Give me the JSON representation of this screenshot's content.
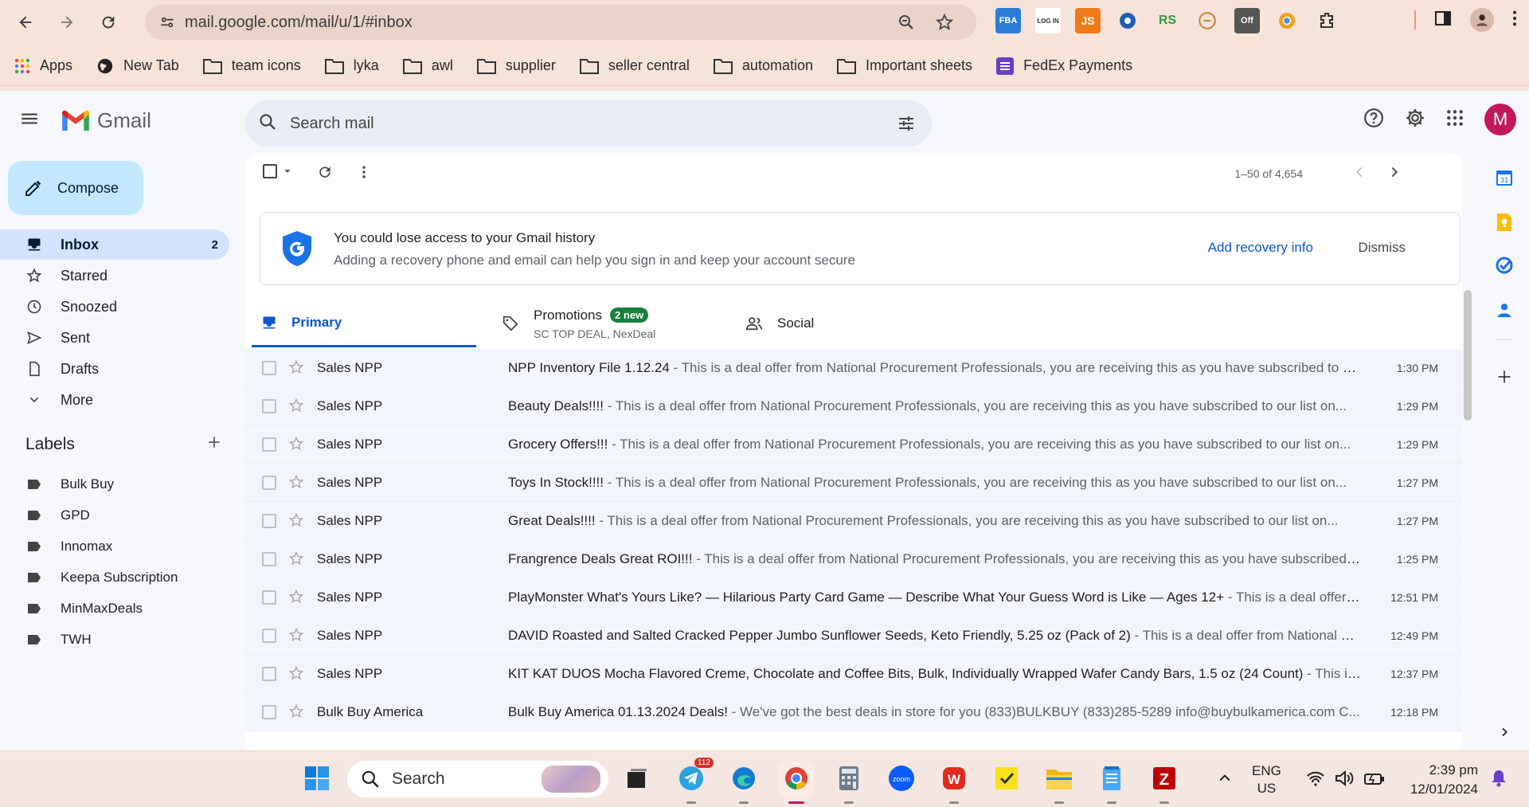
{
  "browser": {
    "url": "mail.google.com/mail/u/1/#inbox",
    "extensions": [
      {
        "name": "fba-ext",
        "label": "FBA",
        "color": "#2b7bd8"
      },
      {
        "name": "login-ext",
        "label": "LOG IN",
        "color": "#555555"
      },
      {
        "name": "js-ext",
        "label": "JS",
        "color": "#f07a1a"
      },
      {
        "name": "helper-ext",
        "label": "",
        "color": "#1e5fb0"
      },
      {
        "name": "rs-ext",
        "label": "RS",
        "color": "#2f9e44"
      },
      {
        "name": "seller-ext",
        "label": "",
        "color": "#c38a4a"
      },
      {
        "name": "off-ext",
        "label": "Off",
        "color": "#666666"
      },
      {
        "name": "chrome-ext",
        "label": "",
        "color": "#f4a21b"
      }
    ]
  },
  "bookmarks": [
    {
      "name": "apps",
      "label": "Apps"
    },
    {
      "name": "new-tab",
      "label": "New Tab"
    },
    {
      "name": "team-icons",
      "label": "team icons"
    },
    {
      "name": "lyka",
      "label": "lyka"
    },
    {
      "name": "awl",
      "label": "awl"
    },
    {
      "name": "supplier",
      "label": "supplier"
    },
    {
      "name": "seller-central",
      "label": "seller central"
    },
    {
      "name": "automation",
      "label": "automation"
    },
    {
      "name": "important-sheets",
      "label": "Important sheets"
    },
    {
      "name": "fedex-payments",
      "label": "FedEx Payments"
    }
  ],
  "gmail": {
    "brand": "Gmail",
    "search_placeholder": "Search mail",
    "avatar_letter": "M",
    "compose_label": "Compose",
    "nav": [
      {
        "label": "Inbox",
        "count": "2",
        "icon": "inbox-icon"
      },
      {
        "label": "Starred",
        "count": "",
        "icon": "star-icon"
      },
      {
        "label": "Snoozed",
        "count": "",
        "icon": "clock-icon"
      },
      {
        "label": "Sent",
        "count": "",
        "icon": "send-icon"
      },
      {
        "label": "Drafts",
        "count": "",
        "icon": "draft-icon"
      },
      {
        "label": "More",
        "count": "",
        "icon": "chevron-down-icon"
      }
    ],
    "labels_title": "Labels",
    "labels": [
      "Bulk Buy",
      "GPD",
      "Innomax",
      "Keepa Subscription",
      "MinMaxDeals",
      "TWH"
    ],
    "pager": "1–50 of 4,654",
    "banner": {
      "title": "You could lose access to your Gmail history",
      "subtitle": "Adding a recovery phone and email can help you sign in and keep your account secure",
      "action": "Add recovery info",
      "dismiss": "Dismiss"
    },
    "tabs": {
      "primary": "Primary",
      "promotions": "Promotions",
      "promotions_badge": "2 new",
      "promotions_sub": "SC TOP DEAL, NexDeal",
      "social": "Social"
    },
    "emails": [
      {
        "sender": "Sales NPP",
        "subject": "NPP Inventory File 1.12.24",
        "snippet": "This is a deal offer from National Procurement Professionals, you are receiving this as you have subscribed to our list on...",
        "time": "1:30 PM"
      },
      {
        "sender": "Sales NPP",
        "subject": "Beauty Deals!!!!",
        "snippet": "This is a deal offer from National Procurement Professionals, you are receiving this as you have subscribed to our list on...",
        "time": "1:29 PM"
      },
      {
        "sender": "Sales NPP",
        "subject": "Grocery Offers!!!",
        "snippet": "This is a deal offer from National Procurement Professionals, you are receiving this as you have subscribed to our list on...",
        "time": "1:29 PM"
      },
      {
        "sender": "Sales NPP",
        "subject": "Toys In Stock!!!!",
        "snippet": "This is a deal offer from National Procurement Professionals, you are receiving this as you have subscribed to our list on...",
        "time": "1:27 PM"
      },
      {
        "sender": "Sales NPP",
        "subject": "Great Deals!!!!",
        "snippet": "This is a deal offer from National Procurement Professionals, you are receiving this as you have subscribed to our list on...",
        "time": "1:27 PM"
      },
      {
        "sender": "Sales NPP",
        "subject": "Frangrence Deals Great ROI!!!",
        "snippet": "This is a deal offer from National Procurement Professionals, you are receiving this as you have subscribed to our list on...",
        "time": "1:25 PM"
      },
      {
        "sender": "Sales NPP",
        "subject": "PlayMonster What's Yours Like? — Hilarious Party Card Game — Describe What Your Guess Word is Like — Ages 12+",
        "snippet": "This is a deal offer from National Procurement Professionals...",
        "time": "12:51 PM"
      },
      {
        "sender": "Sales NPP",
        "subject": "DAVID Roasted and Salted Cracked Pepper Jumbo Sunflower Seeds, Keto Friendly, 5.25 oz (Pack of 2)",
        "snippet": "This is a deal offer from National Procurement Professionals...",
        "time": "12:49 PM"
      },
      {
        "sender": "Sales NPP",
        "subject": "KIT KAT DUOS Mocha Flavored Creme, Chocolate and Coffee Bits, Bulk, Individually Wrapped Wafer Candy Bars, 1.5 oz (24 Count)",
        "snippet": "This is a deal offer...",
        "time": "12:37 PM"
      },
      {
        "sender": "Bulk Buy America",
        "subject": "Bulk Buy America 01.13.2024 Deals!",
        "snippet": "We've got the best deals in store for you (833)BULKBUY (833)285-5289 info@buybulkamerica.com C...",
        "time": "12:18 PM"
      }
    ]
  },
  "taskbar": {
    "search_label": "Search",
    "telegram_badge": "112",
    "lang_line1": "ENG",
    "lang_line2": "US",
    "time": "2:39 pm",
    "date": "12/01/2024"
  }
}
